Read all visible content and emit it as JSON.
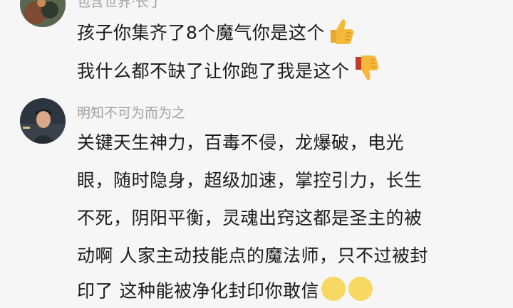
{
  "comments": [
    {
      "username": "包含世界·长了",
      "lines": [
        "孩子你集齐了8个魔气你是这个",
        "我什么都不缺了让你跑了我是这个"
      ],
      "emojis": [
        "thumbs-up-icon",
        "thumbs-down-icon"
      ]
    },
    {
      "username": "明知不可为而为之",
      "lines": [
        "关键天生神力，百毒不侵，龙爆破，电光",
        "眼，随时隐身，超级加速，掌控引力，长生",
        "不死，阴阳平衡，灵魂出窍这都是圣主的被",
        "动啊 人家主动技能点的魔法师，只不过被封",
        "印了 这种能被净化封印你敢信"
      ],
      "emojis": [
        "grimace-face-icon",
        "grimace-face-icon"
      ]
    }
  ],
  "colors": {
    "background": "#f6f6f6",
    "text": "#1b1b1b",
    "username": "#a0a0a0",
    "thumb_yellow": "#f5b83a",
    "thumb_red": "#e2492f"
  }
}
